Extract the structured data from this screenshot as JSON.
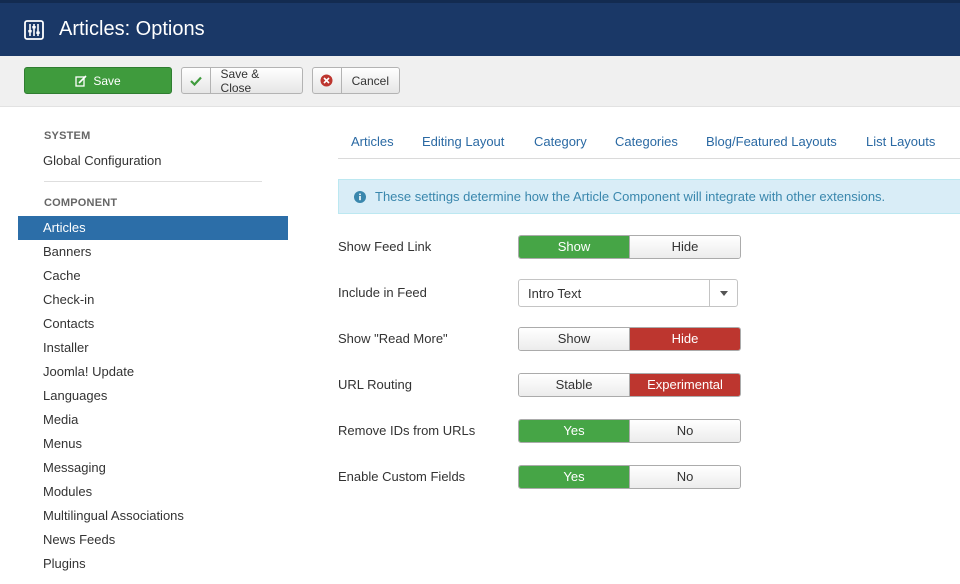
{
  "header": {
    "title": "Articles: Options",
    "icon": "options-sliders-icon"
  },
  "toolbar": {
    "save_label": "Save",
    "save_close_label": "Save & Close",
    "cancel_label": "Cancel"
  },
  "sidebar": {
    "system_heading": "SYSTEM",
    "global_config": "Global Configuration",
    "component_heading": "COMPONENT",
    "items": [
      "Articles",
      "Banners",
      "Cache",
      "Check-in",
      "Contacts",
      "Installer",
      "Joomla! Update",
      "Languages",
      "Media",
      "Menus",
      "Messaging",
      "Modules",
      "Multilingual Associations",
      "News Feeds",
      "Plugins"
    ],
    "active": "Articles"
  },
  "tabs": [
    "Articles",
    "Editing Layout",
    "Category",
    "Categories",
    "Blog/Featured Layouts",
    "List Layouts"
  ],
  "info": "These settings determine how the Article Component will integrate with other extensions.",
  "fields": {
    "feed_link": {
      "label": "Show Feed Link",
      "opt1": "Show",
      "opt2": "Hide",
      "selected": "Show"
    },
    "include_feed": {
      "label": "Include in Feed",
      "value": "Intro Text"
    },
    "read_more": {
      "label": "Show \"Read More\"",
      "opt1": "Show",
      "opt2": "Hide",
      "selected": "Hide"
    },
    "url_routing": {
      "label": "URL Routing",
      "opt1": "Stable",
      "opt2": "Experimental",
      "selected": "Experimental"
    },
    "remove_ids": {
      "label": "Remove IDs from URLs",
      "opt1": "Yes",
      "opt2": "No",
      "selected": "Yes"
    },
    "custom_fields": {
      "label": "Enable Custom Fields",
      "opt1": "Yes",
      "opt2": "No",
      "selected": "Yes"
    }
  },
  "colors": {
    "header": "#1a3867",
    "active_item": "#2c6ea8",
    "green": "#46a546",
    "red": "#bd362f",
    "link": "#2a69a3"
  }
}
